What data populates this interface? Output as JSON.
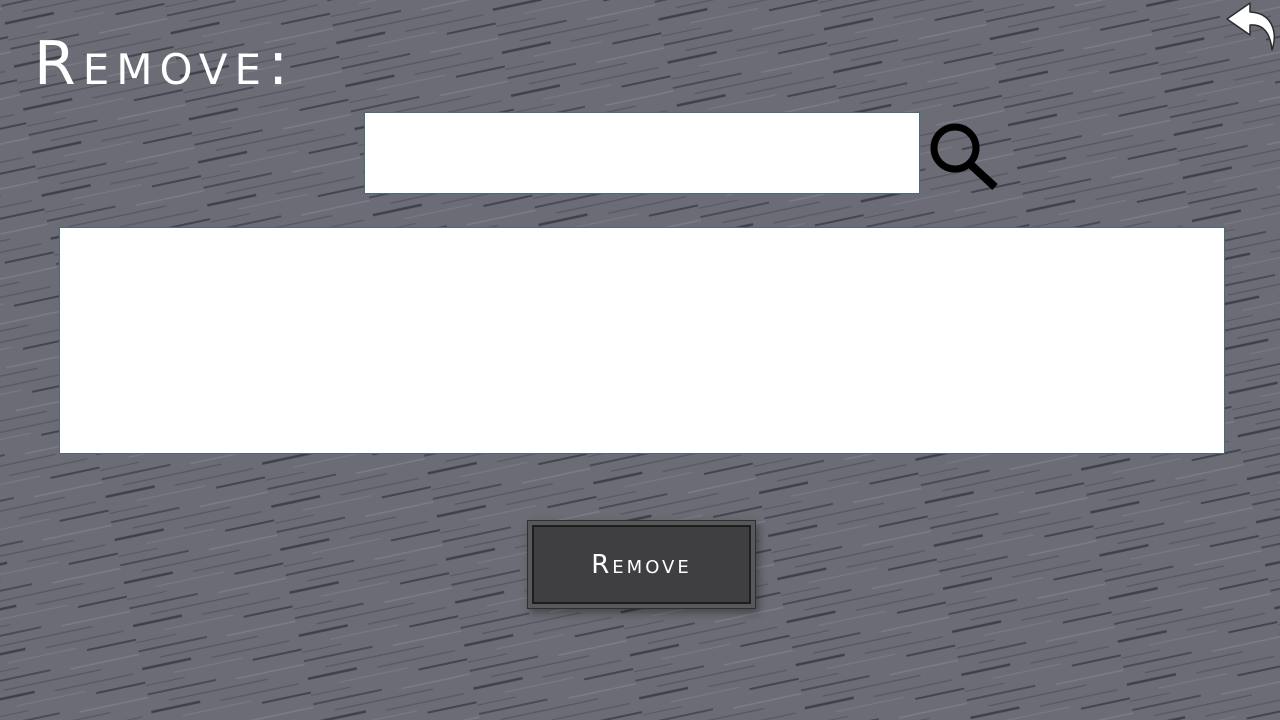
{
  "screen": {
    "title": "Remove:"
  },
  "search": {
    "value": "",
    "placeholder": ""
  },
  "results": {
    "items": []
  },
  "actions": {
    "remove_label": "Remove"
  },
  "icons": {
    "back": "back-arrow-icon",
    "search": "search-icon"
  },
  "colors": {
    "background": "#6b6c75",
    "button_fill": "#3f3f41",
    "text": "#ffffff"
  }
}
